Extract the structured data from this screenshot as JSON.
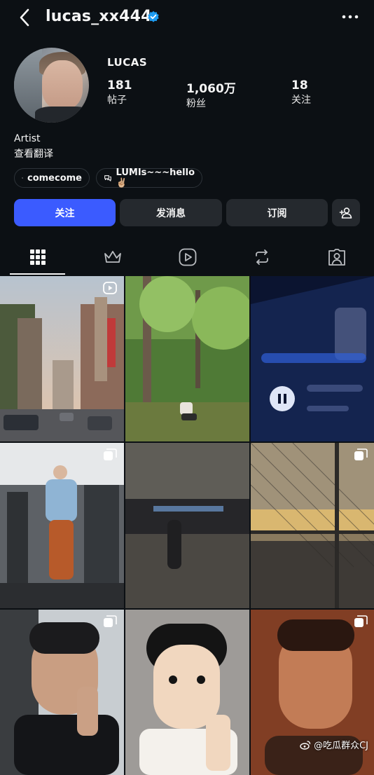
{
  "header": {
    "username": "lucas_xx444",
    "back_icon": "chevron-left-icon",
    "verified_icon": "verified-badge-icon",
    "more_icon": "more-horizontal-icon"
  },
  "profile": {
    "display_name": "LUCAS",
    "stats": [
      {
        "value": "181",
        "label": "帖子"
      },
      {
        "value": "1,060万",
        "label": "粉丝"
      },
      {
        "value": "18",
        "label": "关注"
      }
    ],
    "bio": "Artist",
    "translate": "查看翻译",
    "channels": [
      {
        "label": "comecome",
        "icon": "threads-chat-icon"
      },
      {
        "label": "LUMIs~~~hello✌🏼",
        "icon": "threads-chat-icon"
      }
    ]
  },
  "actions": {
    "follow": "关注",
    "message": "发消息",
    "subscribe": "订阅",
    "add_user_icon": "add-user-icon",
    "accent": "#3b5bff"
  },
  "tabs": [
    {
      "icon": "grid-icon",
      "active": true
    },
    {
      "icon": "crown-icon",
      "active": false
    },
    {
      "icon": "reels-icon",
      "active": false
    },
    {
      "icon": "reposts-icon",
      "active": false
    },
    {
      "icon": "tagged-icon",
      "active": false
    }
  ],
  "posts": [
    {
      "subject": "city street",
      "badge": "reel-icon"
    },
    {
      "subject": "forest",
      "badge": ""
    },
    {
      "subject": "music player screen",
      "badge": ""
    },
    {
      "subject": "runway",
      "badge": "carousel-icon"
    },
    {
      "subject": "motion blur night",
      "badge": ""
    },
    {
      "subject": "sunset fence",
      "badge": "carousel-icon"
    },
    {
      "subject": "selfie peace sign",
      "badge": "carousel-icon"
    },
    {
      "subject": "cartoon portrait",
      "badge": ""
    },
    {
      "subject": "selfie closeup",
      "badge": "carousel-icon"
    }
  ],
  "watermark": "@吃瓜群众CJ"
}
